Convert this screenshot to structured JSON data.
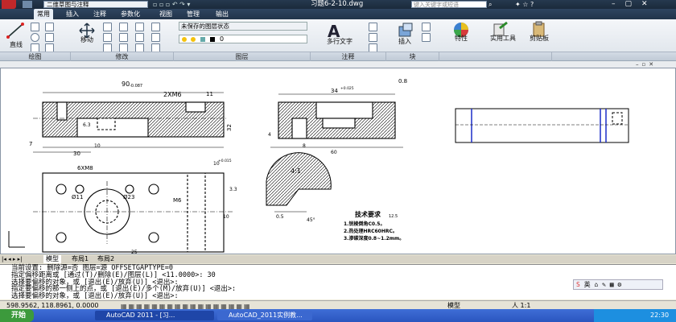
{
  "window": {
    "title": "习题6-2-10.dwg",
    "workspace": "二维草图与注释",
    "search_placeholder": "键入关键字或短语",
    "colors": {
      "titlebar": "#1e2d40",
      "taskbar": "#2a55bf",
      "start": "#3c9a3c"
    }
  },
  "ribbon": {
    "tabs": [
      "常用",
      "插入",
      "注释",
      "参数化",
      "视图",
      "管理",
      "输出"
    ],
    "active_tab": "常用",
    "buttons": {
      "line": "直线",
      "move": "移动",
      "multiline_text": "多行文字",
      "insert": "插入",
      "properties": "特性",
      "utilities": "实用工具",
      "clipboard": "剪贴板"
    },
    "layer_state": "未保存的图层状态",
    "layer_current": "0",
    "groups": [
      "绘图",
      "修改",
      "图层",
      "注释",
      "块"
    ]
  },
  "drawing": {
    "dims": {
      "d90": "90",
      "d90tol": "-0.087",
      "d2xm6": "2XM6",
      "d11": "11",
      "d30": "30",
      "d7": "7",
      "d63": "6.3",
      "d10": "10",
      "d32": "32",
      "d34": "34",
      "d34tol": "+0.025",
      "d08": "0.8",
      "d4": "4",
      "d8": "8",
      "d60": "60",
      "d6xm8": "6XM8",
      "d10b": "10",
      "d10btol": "+0.015",
      "d11c": "Ø11",
      "d23": "Ø23",
      "m6": "M6",
      "d33": "3.3",
      "d10c": "10",
      "d41": "4:1",
      "d05": "0.5",
      "d45": "45°",
      "d25": "25"
    },
    "tech_req_title": "技术要求",
    "tech_req": [
      "1.锐棱倒角C0.5。",
      "2.热处理HRC60HRC。",
      "3.渗碳深度0.8~1.2mm。"
    ],
    "roughness": "12.5"
  },
  "layout_tabs": [
    "模型",
    "布局1",
    "布局2"
  ],
  "command_lines": [
    "当前设置: 删除源=否  图层=源  OFFSETGAPTYPE=0",
    "指定偏移距离或 [通过(T)/删除(E)/图层(L)] <11.0000>:  30",
    "选择要偏移的对象，或 [退出(E)/放弃(U)] <退出>:",
    "指定要偏移的那一侧上的点，或 [退出(E)/多个(M)/放弃(U)] <退出>:",
    "选择要偏移的对象，或 [退出(E)/放弃(U)] <退出>:"
  ],
  "status": {
    "coords": "598.9562, 118.8961, 0.0000",
    "model": "模型",
    "scale": "人 1:1"
  },
  "taskbar": {
    "start": "开始",
    "items": [
      "AutoCAD 2011 - [习...",
      "AutoCAD_2011实例教..."
    ],
    "ime": "英",
    "time": "22:30"
  }
}
